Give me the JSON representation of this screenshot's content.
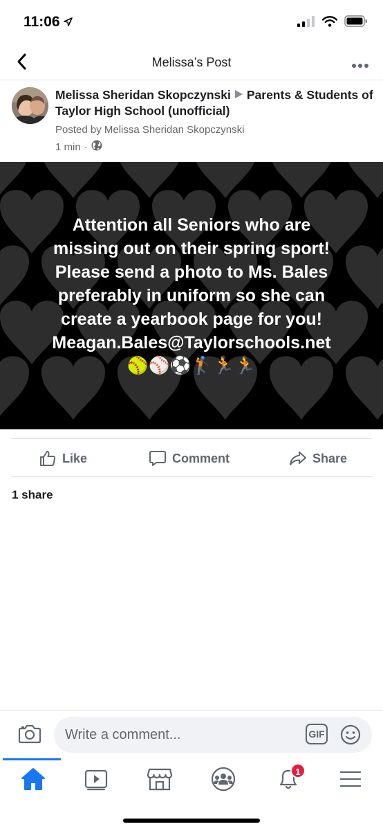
{
  "status_bar": {
    "time": "11:06"
  },
  "nav": {
    "title": "Melissa’s Post"
  },
  "post": {
    "author": "Melissa Sheridan Skopczynski",
    "group": "Parents & Students of Taylor High School (unofficial)",
    "posted_by": "Posted by Melissa Sheridan Skopczynski",
    "time": "1 min",
    "separator": "·",
    "image_text_lines": [
      "Attention all Seniors who are",
      "missing out on their spring  sport!",
      "Please send a photo to Ms. Bales",
      "preferably in uniform so she can",
      "create a yearbook page for you!",
      "Meagan.Bales@Taylorschools.net"
    ],
    "image_emojis": "🥎⚾⚽🏌🏃🏃"
  },
  "actions": {
    "like": "Like",
    "comment": "Comment",
    "share": "Share"
  },
  "shares_count": "1 share",
  "composer": {
    "placeholder": "Write a comment...",
    "gif_label": "GIF"
  },
  "tabbar": {
    "notifications_badge": "1",
    "active_tab": "home"
  },
  "colors": {
    "accent": "#1877f2",
    "badge": "#e41e3f",
    "secondary_text": "#65676b"
  },
  "icons": [
    "location-arrow-icon",
    "signal-icon",
    "wifi-icon",
    "battery-icon",
    "back-chevron-icon",
    "more-dots-icon",
    "globe-icon",
    "like-icon",
    "comment-icon",
    "share-icon",
    "camera-icon",
    "emoji-icon",
    "home-icon",
    "watch-icon",
    "marketplace-icon",
    "groups-icon",
    "bell-icon",
    "menu-icon"
  ]
}
